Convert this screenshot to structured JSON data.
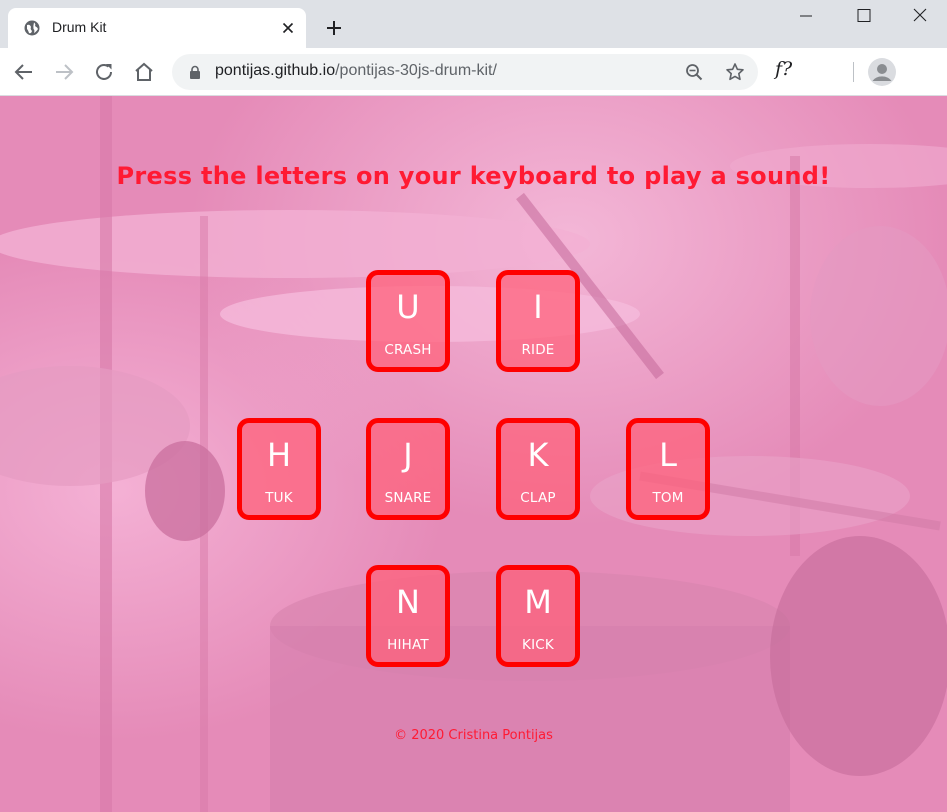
{
  "browser": {
    "tab_title": "Drum Kit",
    "url_host": "pontijas.github.io",
    "url_path": "/pontijas-30js-drum-kit/",
    "extension_label": "f?"
  },
  "page": {
    "headline": "Press the letters on your keyboard to play a sound!",
    "footer": "© 2020 Cristina Pontijas",
    "colors": {
      "accent": "#ff0000",
      "text": "#ff1a33",
      "background": "#e88bb9"
    }
  },
  "keys": [
    {
      "letter": "U",
      "sound": "CRASH"
    },
    {
      "letter": "I",
      "sound": "RIDE"
    },
    {
      "letter": "H",
      "sound": "TUK"
    },
    {
      "letter": "J",
      "sound": "SNARE"
    },
    {
      "letter": "K",
      "sound": "CLAP"
    },
    {
      "letter": "L",
      "sound": "TOM"
    },
    {
      "letter": "N",
      "sound": "HIHAT"
    },
    {
      "letter": "M",
      "sound": "KICK"
    }
  ]
}
